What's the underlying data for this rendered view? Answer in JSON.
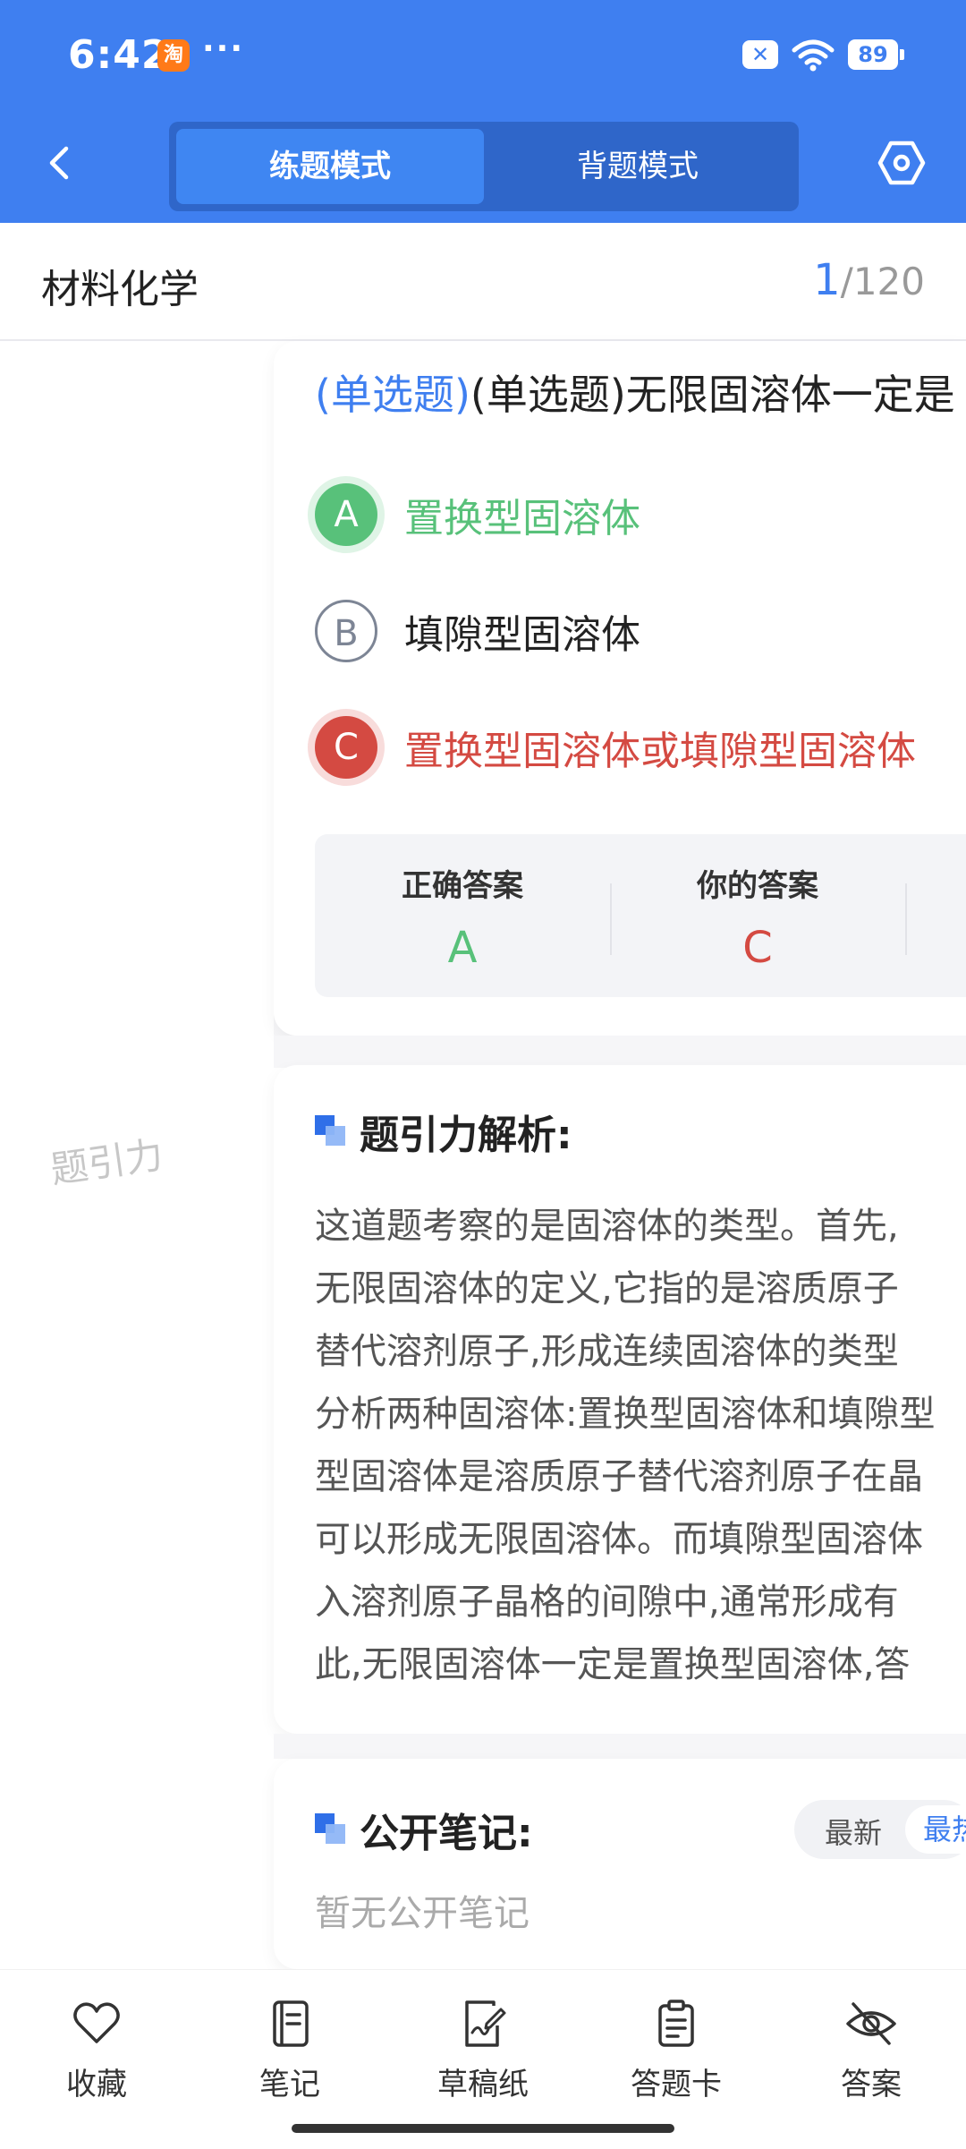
{
  "status_bar": {
    "time": "6:42",
    "taobao_icon_text": "淘",
    "more_dots": "···",
    "notif_icon_text": "✕",
    "battery": "89"
  },
  "nav": {
    "mode_practice": "练题模式",
    "mode_memorize": "背题模式",
    "active_mode": "练题模式"
  },
  "subject": {
    "name": "材料化学",
    "current": "1",
    "total": "/120"
  },
  "watermark": "题引力",
  "question": {
    "tag": "(单选题)",
    "text": "(单选题)无限固溶体一定是"
  },
  "options": [
    {
      "letter": "A",
      "text": "置换型固溶体",
      "state": "correct"
    },
    {
      "letter": "B",
      "text": "填隙型固溶体",
      "state": "neutral"
    },
    {
      "letter": "C",
      "text": "置换型固溶体或填隙型固溶体",
      "state": "wrong"
    }
  ],
  "answers": {
    "correct_label": "正确答案",
    "correct_value": "A",
    "yours_label": "你的答案",
    "yours_value": "C"
  },
  "analysis": {
    "title": "题引力解析:",
    "lines": [
      "这道题考察的是固溶体的类型。首先,",
      "无限固溶体的定义,它指的是溶质原子",
      "替代溶剂原子,形成连续固溶体的类型",
      "分析两种固溶体:置换型固溶体和填隙型",
      "型固溶体是溶质原子替代溶剂原子在晶",
      "可以形成无限固溶体。而填隙型固溶体",
      "入溶剂原子晶格的间隙中,通常形成有",
      "此,无限固溶体一定是置换型固溶体,答"
    ]
  },
  "notes": {
    "title": "公开笔记:",
    "sort_new": "最新",
    "sort_hot": "最热",
    "empty": "暂无公开笔记"
  },
  "toolbar": {
    "favorite": "收藏",
    "notes": "笔记",
    "scratch": "草稿纸",
    "answer_card": "答题卡",
    "answer": "答案"
  },
  "colors": {
    "primary": "#3f7ff0",
    "correct": "#58c17a",
    "wrong": "#d44a42"
  },
  "icons": [
    "back-chevron-icon",
    "settings-hexagon-icon",
    "heart-icon",
    "notebook-icon",
    "scratch-pad-icon",
    "clipboard-icon",
    "eye-off-icon"
  ]
}
